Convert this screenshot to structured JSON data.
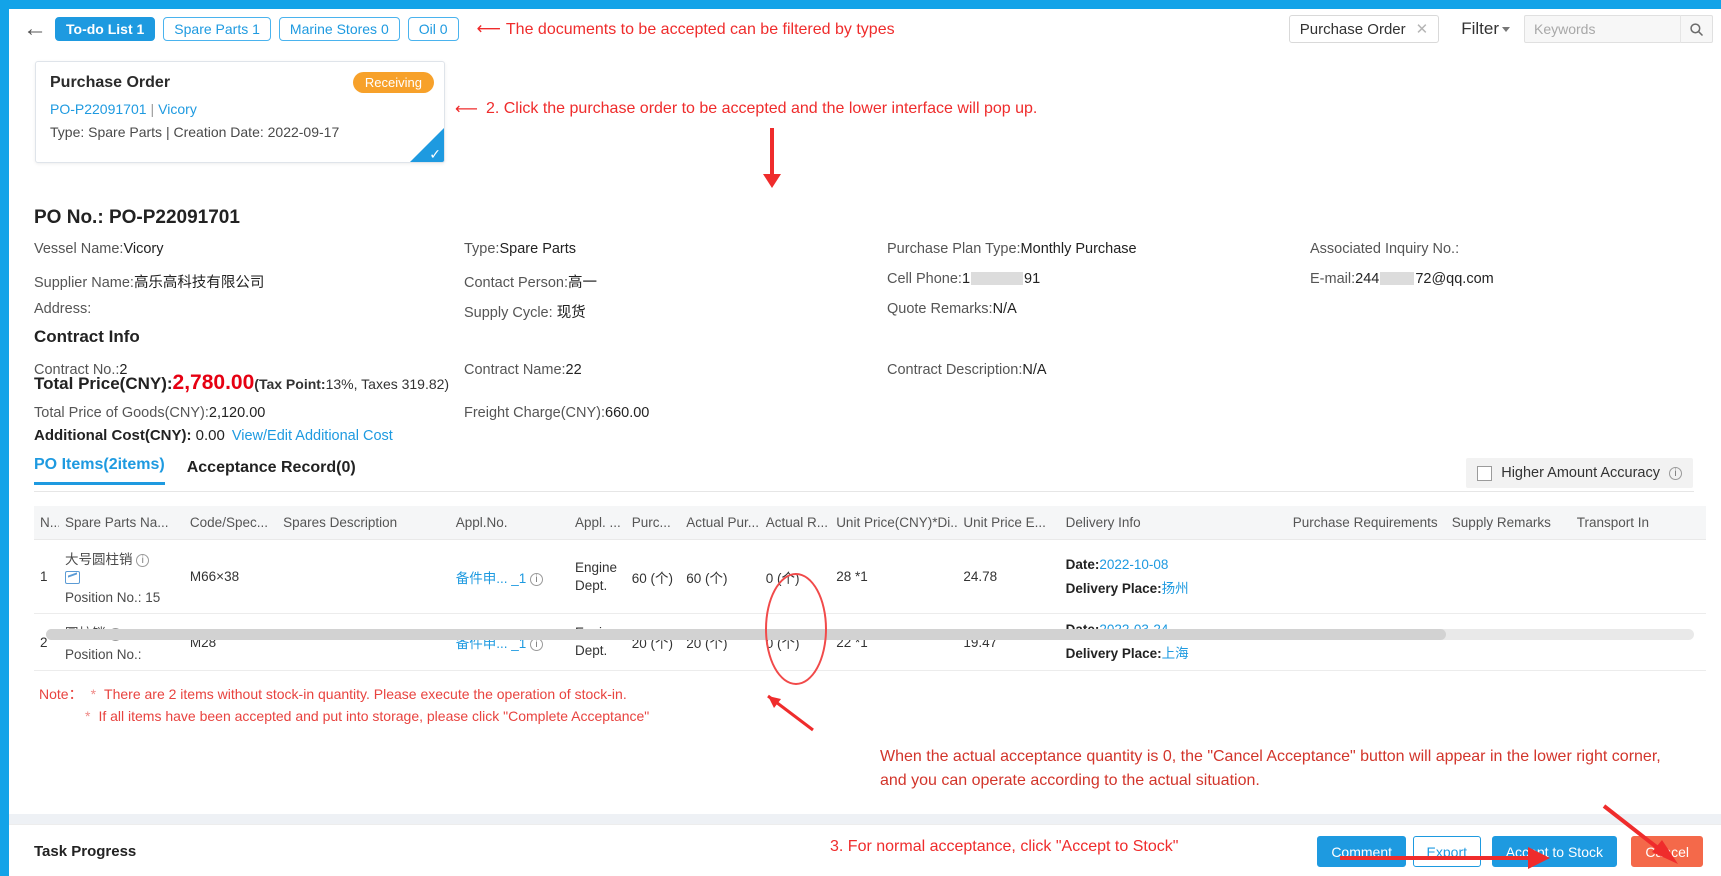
{
  "toolbar": {
    "back_icon": "back-arrow-icon",
    "chips": [
      {
        "label": "To-do List 1",
        "active": true
      },
      {
        "label": "Spare Parts 1",
        "active": false
      },
      {
        "label": "Marine Stores 0",
        "active": false
      },
      {
        "label": "Oil 0",
        "active": false
      }
    ],
    "annotation_1": "The documents to be accepted can be filtered by types",
    "filter_tag": "Purchase Order",
    "filter_tag_close_icon": "close-icon",
    "filter_label": "Filter",
    "search_placeholder": "Keywords",
    "search_value": "",
    "search_icon": "search-icon"
  },
  "card": {
    "title": "Purchase Order",
    "badge": "Receiving",
    "po_no": "PO-P22091701",
    "separator": "|",
    "vessel": "Vicory",
    "meta": "Type:  Spare Parts | Creation Date:  2022-09-17",
    "selected_icon": "check-corner-icon"
  },
  "annotations": {
    "step2": "2. Click the purchase order to be accepted and the lower interface will pop up.",
    "actual_qty_note": "When the actual acceptance quantity is 0, the \"Cancel Acceptance\" button will appear in the lower right corner, and you can operate according to the actual situation.",
    "step3": "3. For normal acceptance, click \"Accept to Stock\""
  },
  "detail": {
    "po_no_label": "PO No.:",
    "po_no_value": "PO-P22091701",
    "fields": [
      {
        "label": "Vessel Name:",
        "value": "Vicory"
      },
      {
        "label": "Type:",
        "value": "Spare Parts"
      },
      {
        "label": "Purchase Plan Type:",
        "value": "Monthly Purchase"
      },
      {
        "label": "Associated Inquiry No.:",
        "value": ""
      },
      {
        "label": "Supplier Name:",
        "value": "高乐高科技有限公司"
      },
      {
        "label": "Contact Person:",
        "value": "高一"
      },
      {
        "label": "Cell Phone:",
        "value": "1",
        "value_suffix": "91",
        "redacted": true
      },
      {
        "label": "E-mail:",
        "value": "244",
        "value_suffix": "72@qq.com",
        "redacted": true
      },
      {
        "label": "Address:",
        "value": ""
      },
      {
        "label": "Supply Cycle: ",
        "value": "现货"
      },
      {
        "label": "Quote Remarks:",
        "value": "N/A"
      }
    ],
    "contract_heading": "Contract Info",
    "contract": [
      {
        "label": "Contract No.:",
        "value": "2"
      },
      {
        "label": "Contract Name:",
        "value": "22"
      },
      {
        "label": "Contract Description:",
        "value": "N/A"
      }
    ],
    "total_price_label": "Total Price(CNY):",
    "total_price_value": "2,780.00",
    "tax_prefix": "(Tax Point:",
    "tax_point": "13%",
    "tax_amount": ", Taxes 319.82)",
    "total_goods_label": "Total Price of Goods(CNY):",
    "total_goods_value": "2,120.00",
    "freight_label": "Freight Charge(CNY):",
    "freight_value": "660.00",
    "additional_label": "Additional Cost(CNY):",
    "additional_value": "0.00",
    "additional_link": "View/Edit Additional Cost",
    "tabs": [
      {
        "label": "PO Items(2items)",
        "active": true
      },
      {
        "label": "Acceptance Record(0)",
        "active": false
      }
    ],
    "higher_accuracy_label": "Higher Amount Accuracy",
    "higher_accuracy_checked": false,
    "higher_accuracy_info_icon": "info-icon"
  },
  "table": {
    "columns": [
      "N...",
      "Spare Parts Na...",
      "Code/Spec...",
      "Spares Description",
      "Appl.No.",
      "Appl. ...",
      "Purc...",
      "Actual Pur...",
      "Actual R...",
      "Unit Price(CNY)*Di...",
      "Unit Price E...",
      "Delivery Info",
      "Purchase Requirements",
      "Supply Remarks",
      "Transport In"
    ],
    "rows": [
      {
        "no": "1",
        "spare_parts_name": "大号圆柱销",
        "has_image_icon": true,
        "position_label": "Position No.:",
        "position_value": "15",
        "code_spec": "M66×38",
        "spares_description": "",
        "appl_no": "备件申... _1",
        "appl_dept": "Engine Dept.",
        "purc_qty": "60 (个)",
        "actual_pur_qty": "60 (个)",
        "actual_recv_qty": "0 (个)",
        "unit_price_discount": "28 *1",
        "unit_price_excl": "24.78",
        "delivery_date_label": "Date:",
        "delivery_date": "2022-10-08",
        "delivery_place_label": "Delivery Place:",
        "delivery_place": "扬州",
        "purchase_requirements": "",
        "supply_remarks": ""
      },
      {
        "no": "2",
        "spare_parts_name": "圆柱销",
        "has_image_icon": false,
        "position_label": "Position No.:",
        "position_value": "",
        "code_spec": "M28",
        "spares_description": "",
        "appl_no": "备件申... _1",
        "appl_dept": "Engine Dept.",
        "purc_qty": "20 (个)",
        "actual_pur_qty": "20 (个)",
        "actual_recv_qty": "0 (个)",
        "unit_price_discount": "22 *1",
        "unit_price_excl": "19.47",
        "delivery_date_label": "Date:",
        "delivery_date": "2022-03-24",
        "delivery_place_label": "Delivery Place:",
        "delivery_place": "上海",
        "purchase_requirements": "",
        "supply_remarks": ""
      }
    ]
  },
  "notes": {
    "label": "Note：",
    "items": [
      "There are 2 items without stock-in quantity. Please execute the operation of stock-in.",
      "If all items have been accepted and put into storage, please click \"Complete Acceptance\""
    ]
  },
  "footer": {
    "task_progress": "Task Progress",
    "buttons": [
      {
        "label": "Comment",
        "style": "primary"
      },
      {
        "label": "Export",
        "style": "ghost"
      },
      {
        "label": "Accept to Stock",
        "style": "primary"
      },
      {
        "label": "Cancel",
        "style": "danger"
      }
    ]
  },
  "colors": {
    "brand": "#1e9ae0",
    "badge": "#f7a12a",
    "danger": "#ef2c2c",
    "price": "#e60012",
    "cancel": "#f4694a"
  }
}
